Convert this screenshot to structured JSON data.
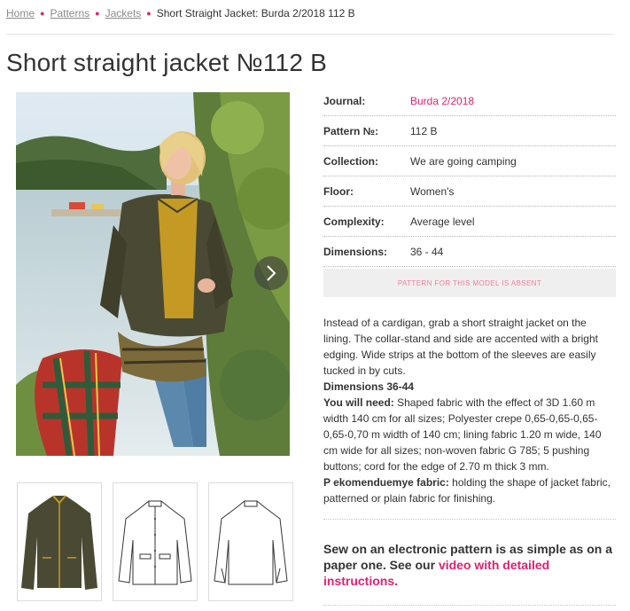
{
  "breadcrumb": {
    "items": [
      "Home",
      "Patterns",
      "Jackets"
    ],
    "current": "Short Straight Jacket: Burda 2/2018 112 B"
  },
  "page_title": "Short straight jacket №112 B",
  "details": [
    {
      "label": "Journal:",
      "value": "Burda 2/2018",
      "link": true
    },
    {
      "label": "Pattern №:",
      "value": "112 B",
      "link": false
    },
    {
      "label": "Collection:",
      "value": "We are going camping",
      "link": false
    },
    {
      "label": "Floor:",
      "value": "Women's",
      "link": false
    },
    {
      "label": "Complexity:",
      "value": "Average level",
      "link": false
    },
    {
      "label": "Dimensions:",
      "value": "36 - 44",
      "link": false
    }
  ],
  "absent_notice": "PATTERN FOR THIS MODEL IS ABSENT",
  "description": {
    "intro": "Instead of a cardigan, grab a short straight jacket on the lining. The collar-stand and side are accented with a bright edging. Wide strips at the bottom of the sleeves are easily tucked in by cuts.",
    "dimensions_heading": "Dimensions 36-44",
    "need_label": "You will need:",
    "need_text": " Shaped fabric with the effect of 3D 1.60 m width 140 cm for all sizes; Polyester crepe 0,65-0,65-0,65-0,65-0,70 m width of 140 cm; lining fabric 1.20 m wide, 140 cm wide for all sizes; non-woven fabric G 785; 5 pushing buttons; cord for the edge of 2.70 m thick 3 mm.",
    "fabric_label": "P ekomenduemye fabric:",
    "fabric_text": " holding the shape of jacket fabric, patterned or plain fabric for finishing."
  },
  "promo": {
    "text": "Sew on an electronic pattern is as simple as on a paper one. See our ",
    "link": "video with detailed instructions."
  },
  "colors": {
    "accent": "#e0216e",
    "jacket": "#4a4a34",
    "sweater": "#c49a25"
  },
  "icons": {
    "gallery_next": "chevron-right-icon"
  }
}
